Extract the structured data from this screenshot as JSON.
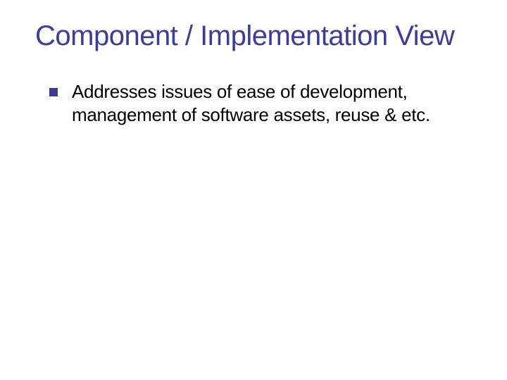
{
  "slide": {
    "title": "Component / Implementation View",
    "bullets": [
      {
        "text": "Addresses issues of ease of development, management of software assets, reuse & etc."
      }
    ]
  }
}
